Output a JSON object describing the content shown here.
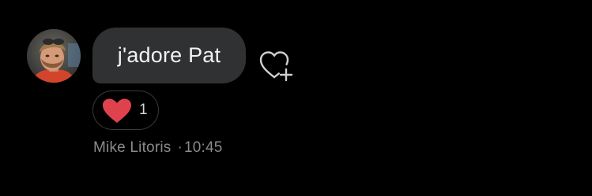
{
  "message": {
    "text": "j'adore Pat",
    "sender": "Mike Litoris",
    "separator": "·",
    "time": "10:45"
  },
  "reactions": [
    {
      "icon": "heart-icon",
      "count": "1",
      "color": "#e0424d"
    }
  ],
  "react_button": {
    "icon": "heart-plus-icon"
  },
  "colors": {
    "background": "#000000",
    "bubble": "#303133",
    "meta_text": "#8a8a8e",
    "heart": "#e0424d"
  }
}
